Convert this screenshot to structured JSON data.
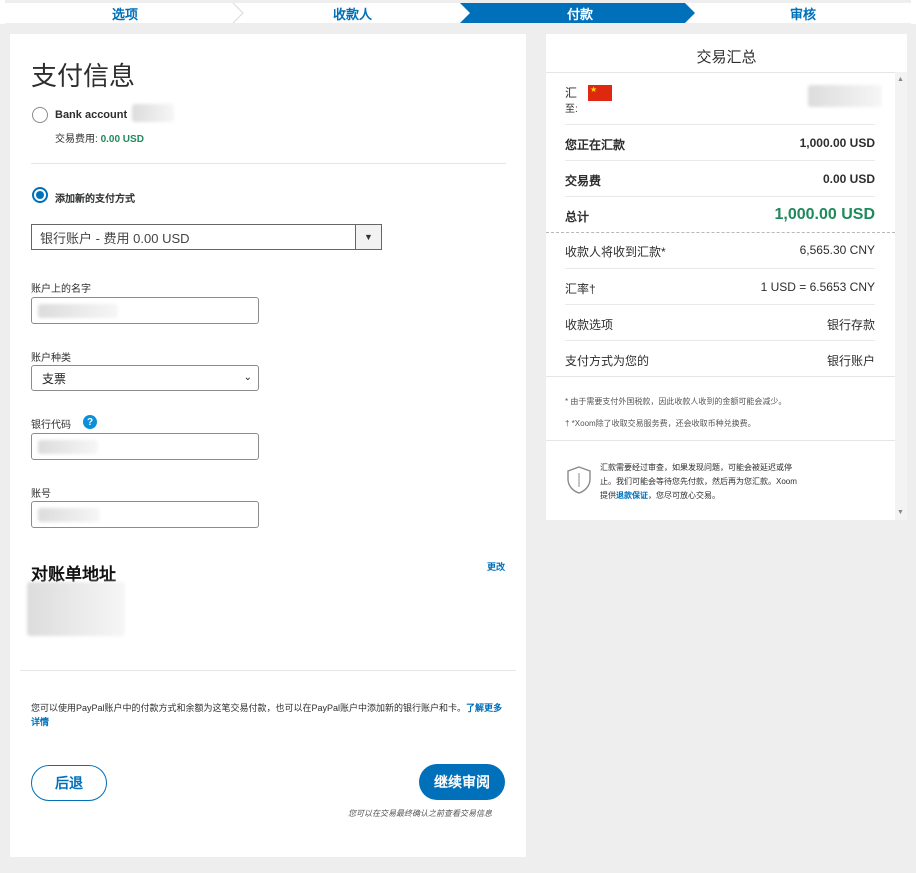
{
  "steps": {
    "s1": "选项",
    "s2": "收款人",
    "s3": "付款",
    "s4": "审核"
  },
  "payment": {
    "title": "支付信息",
    "bank_option_label": "Bank account",
    "fee_label": "交易费用:",
    "fee_value": "0.00 USD",
    "new_method_label": "添加新的支付方式",
    "method_select_value": "银行账户 - 费用 0.00 USD",
    "name_label": "账户上的名字",
    "account_type_label": "账户种类",
    "account_type_value": "支票",
    "bank_code_label": "银行代码",
    "account_no_label": "账号",
    "billing_title": "对账单地址",
    "change_link": "更改",
    "info_text": "您可以使用PayPal账户中的付款方式和余额为这笔交易付款，也可以在PayPal账户中添加新的银行账户和卡。",
    "learn_more": "了解更多详情",
    "back_button": "后退",
    "continue_button": "继续审阅",
    "review_note": "您可以在交易最终确认之前查看交易信息"
  },
  "summary": {
    "title": "交易汇总",
    "send_to_line1": "汇",
    "send_to_line2": "至:",
    "rows": [
      {
        "k": "您正在汇款",
        "v": "1,000.00  USD"
      },
      {
        "k": "交易费",
        "v": "0.00  USD"
      },
      {
        "k": "总计",
        "v": "1,000.00  USD"
      },
      {
        "k": "收款人将收到汇款*",
        "v": "6,565.30  CNY"
      },
      {
        "k": "汇率†",
        "v": "1 USD = 6.5653 CNY"
      },
      {
        "k": "收款选项",
        "v": "银行存款"
      },
      {
        "k": "支付方式为您的",
        "v": "银行账户"
      }
    ],
    "footnote1": "* 由于需要支付外国税款，因此收款人收到的金额可能会减少。",
    "footnote2": "† *Xoom除了收取交易服务费，还会收取币种兑换费。",
    "guarantee_text1": "汇款需要经过审查，如果发现问题，可能会被延迟或停",
    "guarantee_text2": "止。我们可能会等待您先付款，然后再为您汇款。Xoom",
    "guarantee_text3a": "提供",
    "guarantee_link": "退款保证",
    "guarantee_text3b": "，您尽可放心交易。"
  },
  "colors": {
    "brand": "#0070ba",
    "green": "#1f8a5b"
  }
}
